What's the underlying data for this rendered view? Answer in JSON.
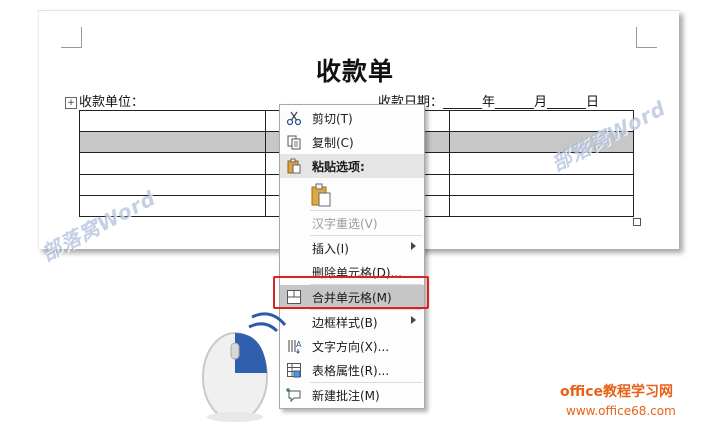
{
  "document": {
    "title": "收款单",
    "payer_label": "收款单位：",
    "date_label": "收款日期：______年______月______日",
    "table": {
      "rows": 5,
      "selected_row": 1
    }
  },
  "watermark": {
    "text": "部落窝Word"
  },
  "context_menu": {
    "items": [
      {
        "label": "剪切(T)",
        "icon": "cut-icon"
      },
      {
        "label": "复制(C)",
        "icon": "copy-icon"
      },
      {
        "label": "粘贴选项:",
        "icon": "paste-icon"
      },
      {
        "label": "",
        "icon": "paste-keep-format-icon"
      },
      {
        "label": "汉字重选(V)",
        "icon": ""
      },
      {
        "label": "插入(I)",
        "icon": "",
        "submenu": true
      },
      {
        "label": "删除单元格(D)...",
        "icon": ""
      },
      {
        "label": "合并单元格(M)",
        "icon": "merge-cells-icon"
      },
      {
        "label": "边框样式(B)",
        "icon": "",
        "submenu": true
      },
      {
        "label": "文字方向(X)...",
        "icon": "text-direction-icon"
      },
      {
        "label": "表格属性(R)...",
        "icon": "table-properties-icon"
      },
      {
        "label": "新建批注(M)",
        "icon": "new-comment-icon"
      }
    ],
    "highlighted": "合并单元格(M)",
    "highlight_color": "#e02020"
  },
  "site": {
    "title": "office教程学习网",
    "url": "www.office68.com",
    "color": "#e8611a"
  }
}
